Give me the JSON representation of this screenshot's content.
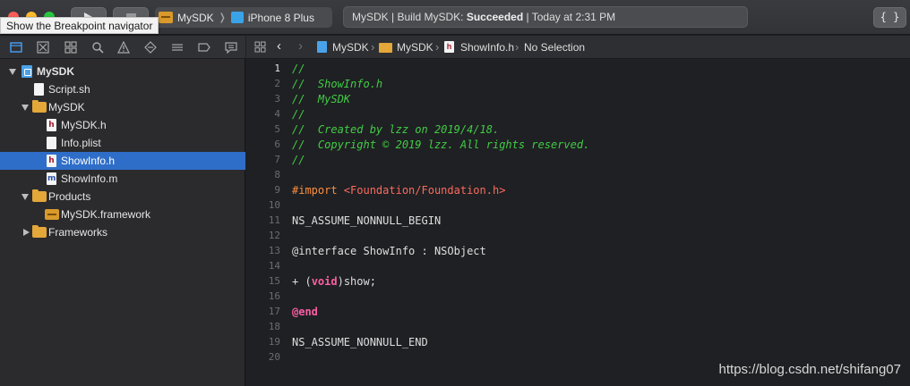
{
  "toolbar": {
    "scheme_target": "MySDK",
    "scheme_device": "iPhone 8 Plus",
    "activity_prefix": "MySDK | Build MySDK: ",
    "activity_status": "Succeeded",
    "activity_suffix": " | Today at 2:31 PM",
    "braces_label": "{ }"
  },
  "tooltip": "Show the Breakpoint navigator",
  "navigator": {
    "tabs": [
      "project-navigator",
      "source-control-navigator",
      "symbol-navigator",
      "find-navigator",
      "issue-navigator",
      "test-navigator",
      "debug-navigator",
      "breakpoint-navigator",
      "report-navigator"
    ],
    "tree": [
      {
        "label": "MySDK",
        "icon": "project-icon",
        "expanded": true
      },
      {
        "label": "Script.sh",
        "icon": "document-icon"
      },
      {
        "label": "MySDK",
        "icon": "folder-icon",
        "expanded": true
      },
      {
        "label": "MySDK.h",
        "icon": "header-file-icon",
        "letter": "h"
      },
      {
        "label": "Info.plist",
        "icon": "plist-file-icon"
      },
      {
        "label": "ShowInfo.h",
        "icon": "header-file-icon",
        "letter": "h",
        "selected": true
      },
      {
        "label": "ShowInfo.m",
        "icon": "implementation-file-icon",
        "letter": "m"
      },
      {
        "label": "Products",
        "icon": "folder-icon",
        "expanded": true
      },
      {
        "label": "MySDK.framework",
        "icon": "framework-icon"
      },
      {
        "label": "Frameworks",
        "icon": "folder-icon",
        "expanded": false
      }
    ]
  },
  "jumpbar": {
    "crumbs": [
      "MySDK",
      "MySDK",
      "ShowInfo.h",
      "No Selection"
    ]
  },
  "editor": {
    "lines": [
      {
        "n": "1",
        "text": "//",
        "kind": "comment"
      },
      {
        "n": "2",
        "text": "//  ShowInfo.h",
        "kind": "comment"
      },
      {
        "n": "3",
        "text": "//  MySDK",
        "kind": "comment"
      },
      {
        "n": "4",
        "text": "//",
        "kind": "comment"
      },
      {
        "n": "5",
        "text": "//  Created by lzz on 2019/4/18.",
        "kind": "comment"
      },
      {
        "n": "6",
        "text": "//  Copyright © 2019 lzz. All rights reserved.",
        "kind": "comment"
      },
      {
        "n": "7",
        "text": "//",
        "kind": "comment"
      },
      {
        "n": "8",
        "text": "",
        "kind": "plain"
      },
      {
        "n": "9",
        "text_pre": "#import ",
        "text_str": "<Foundation/Foundation.h>",
        "kind": "import"
      },
      {
        "n": "10",
        "text": "",
        "kind": "plain"
      },
      {
        "n": "11",
        "text": "NS_ASSUME_NONNULL_BEGIN",
        "kind": "plain"
      },
      {
        "n": "12",
        "text": "",
        "kind": "plain"
      },
      {
        "n": "13",
        "text": "@interface ShowInfo : NSObject",
        "kind": "plain"
      },
      {
        "n": "14",
        "text": "",
        "kind": "plain"
      },
      {
        "n": "15",
        "text_a": "+ (",
        "text_kw": "void",
        "text_b": ")show;",
        "kind": "method"
      },
      {
        "n": "16",
        "text": "",
        "kind": "plain"
      },
      {
        "n": "17",
        "text": "@end",
        "kind": "keyword"
      },
      {
        "n": "18",
        "text": "",
        "kind": "plain"
      },
      {
        "n": "19",
        "text": "NS_ASSUME_NONNULL_END",
        "kind": "plain"
      },
      {
        "n": "20",
        "text": "",
        "kind": "plain"
      }
    ]
  },
  "watermark": "https://blog.csdn.net/shifang07"
}
